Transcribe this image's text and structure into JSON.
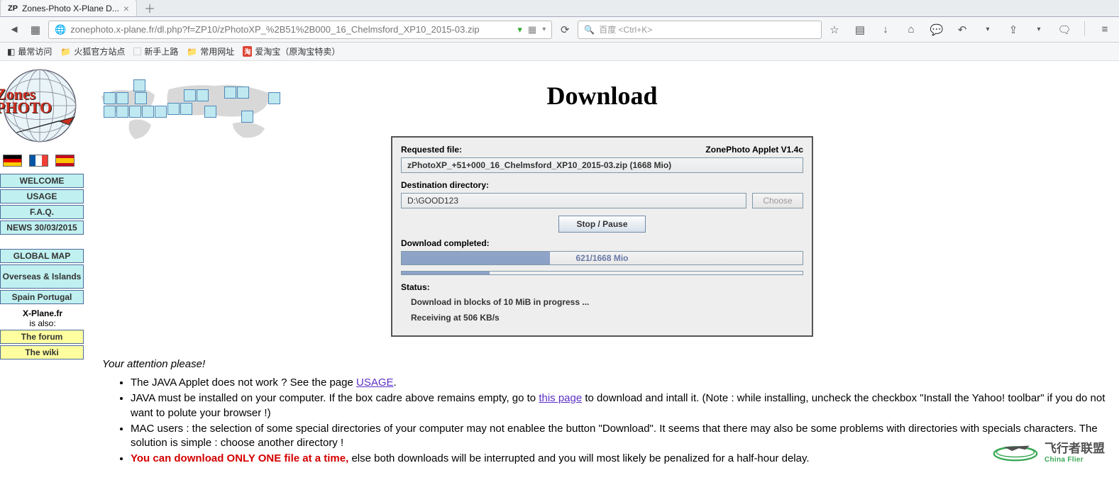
{
  "browser": {
    "tab_title": "Zones-Photo X-Plane D...",
    "url": "zonephoto.x-plane.fr/dl.php?f=ZP10/zPhotoXP_%2B51%2B000_16_Chelmsford_XP10_2015-03.zip",
    "search_placeholder": "百度 <Ctrl+K>",
    "bookmarks": {
      "most_visited": "最常访问",
      "firefox_official": "火狐官方站点",
      "getting_started": "新手上路",
      "common_sites": "常用网址",
      "aitaobao": "爱淘宝（原淘宝特卖）"
    }
  },
  "sidebar": {
    "items": [
      {
        "label": "WELCOME"
      },
      {
        "label": "USAGE"
      },
      {
        "label": "F.A.Q."
      },
      {
        "label": "NEWS 30/03/2015"
      }
    ],
    "group2": [
      {
        "label": "GLOBAL MAP"
      },
      {
        "label": "Overseas & Islands"
      },
      {
        "label": "Spain Portugal"
      }
    ],
    "also_label_1": "X-Plane.fr",
    "also_label_2": "is also:",
    "forum": "The forum",
    "wiki": "The wiki"
  },
  "page": {
    "heading": "Download",
    "applet": {
      "requested_label": "Requested file:",
      "version": "ZonePhoto Applet V1.4c",
      "file": "zPhotoXP_+51+000_16_Chelmsford_XP10_2015-03.zip (1668 Mio)",
      "dest_label": "Destination directory:",
      "dest_value": "D:\\GOOD123",
      "choose": "Choose",
      "stop_pause": "Stop / Pause",
      "download_label": "Download completed:",
      "progress_pct": 37,
      "progress_text": "621/1668 Mio",
      "thin_pct": 22,
      "status_label": "Status:",
      "status_line_1": "Download in blocks of 10 MiB in progress ...",
      "status_line_2": "Receiving at 506 KB/s"
    },
    "attention": "Your attention please!",
    "bullets": {
      "b1a": "The JAVA Applet does not work ? See the page ",
      "b1_link": "USAGE",
      "b1b": ".",
      "b2a": "JAVA must be installed on your computer. If the box cadre above remains empty, go to ",
      "b2_link": "this page",
      "b2b": " to download and intall it. (Note : while installing, uncheck the checkbox \"Install the Yahoo! toolbar\" if you do not want to polute your browser !)",
      "b3": "MAC users : the selection of some special directories of your computer may not enablee the button \"Download\". It seems that there may also be some problems with directories with specials characters. The solution is simple : choose another directory !",
      "b4_red": "You can download ONLY ONE file at a time,",
      "b4_rest": " else both downloads will be interrupted and you will most likely be penalized for a half-hour delay."
    }
  },
  "watermark": {
    "cn": "飞行者联盟",
    "en": "China Flier"
  }
}
